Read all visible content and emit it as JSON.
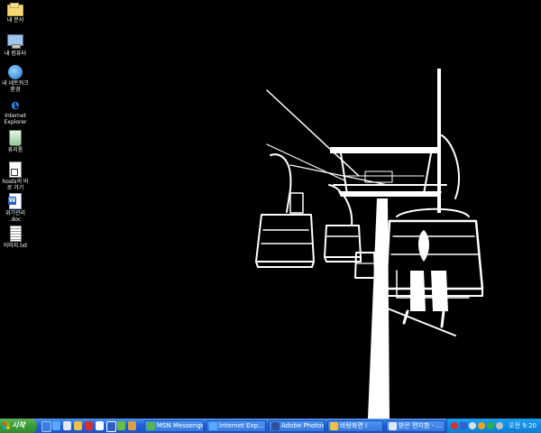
{
  "desktop": {
    "icons": [
      {
        "label": "내 문서",
        "glyph": "folder-icon"
      },
      {
        "label": "내 컴퓨터",
        "glyph": "computer-icon"
      },
      {
        "label": "내 네트워크 환경",
        "glyph": "network-icon"
      },
      {
        "label": "Internet Explorer",
        "glyph": "ie-icon"
      },
      {
        "label": "휴지통",
        "glyph": "recycle-bin-icon"
      },
      {
        "label": "hosts의 바로 가기",
        "glyph": "shortcut-icon"
      },
      {
        "label": "위기관리 .doc",
        "glyph": "word-doc-icon"
      },
      {
        "label": "이미지.txt",
        "glyph": "text-file-icon"
      }
    ]
  },
  "taskbar": {
    "start_label": "시작",
    "buttons": [
      {
        "label": "MSN Messenger",
        "glyph": "msn-icon"
      },
      {
        "label": "Internet Exp...",
        "glyph": "ie-icon"
      },
      {
        "label": "Adobe Photos...",
        "glyph": "photoshop-icon"
      },
      {
        "label": "바탕화면 I",
        "glyph": "folder-icon"
      },
      {
        "label": "받은 편지함 - ...",
        "glyph": "mail-icon"
      }
    ],
    "tray": {
      "clock": "오전 9:20"
    }
  },
  "colors": {
    "desktop_bg": "#000000",
    "taskbar": "#245edb",
    "start_button": "#3c9a38",
    "tray": "#0f8ae3"
  }
}
